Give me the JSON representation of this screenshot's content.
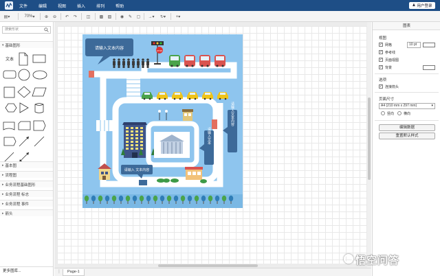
{
  "menu": [
    "文件",
    "编辑",
    "视图",
    "插入",
    "排列",
    "帮助"
  ],
  "user_button": "用户登录",
  "toolbar": {
    "zoom": "70%"
  },
  "left_panel": {
    "search_placeholder": "搜索形状",
    "basic_shapes": "基础图形",
    "text_shape": "文本",
    "sections": [
      "基本图",
      "流程图",
      "业务流程基础图形",
      "业务流程 标志",
      "业务流程 事件",
      "箭头"
    ],
    "more": "更多图库..."
  },
  "canvas": {
    "callout_top": "请输入文本内容",
    "callout_bottom": "请输入 文本内容",
    "vert_a": "请输入文本",
    "vert_b": "请输入文本内容",
    "stop_sign": "STOP"
  },
  "page_tab": "Page-1",
  "right_panel": {
    "title": "图表",
    "view_label": "视图",
    "grid": "网格",
    "grid_size": "10 pt",
    "guides": "参考线",
    "page_view": "页面视图",
    "background": "背景",
    "options_label": "选项",
    "connection_arrows": "连接箭头",
    "paper_size_label": "页面尺寸",
    "paper_size": "A4 (210 mm x 297 mm)",
    "portrait": "竖向",
    "landscape": "横向",
    "edit_data": "编辑数据",
    "reset_style": "重置默认样式"
  },
  "watermark": "悟空问答",
  "colors": {
    "topbar": "#1e4e86",
    "map_bg": "#8ec5ee",
    "road": "#ffffff",
    "callout": "#3d6a99",
    "grass": "#4aa34a"
  }
}
